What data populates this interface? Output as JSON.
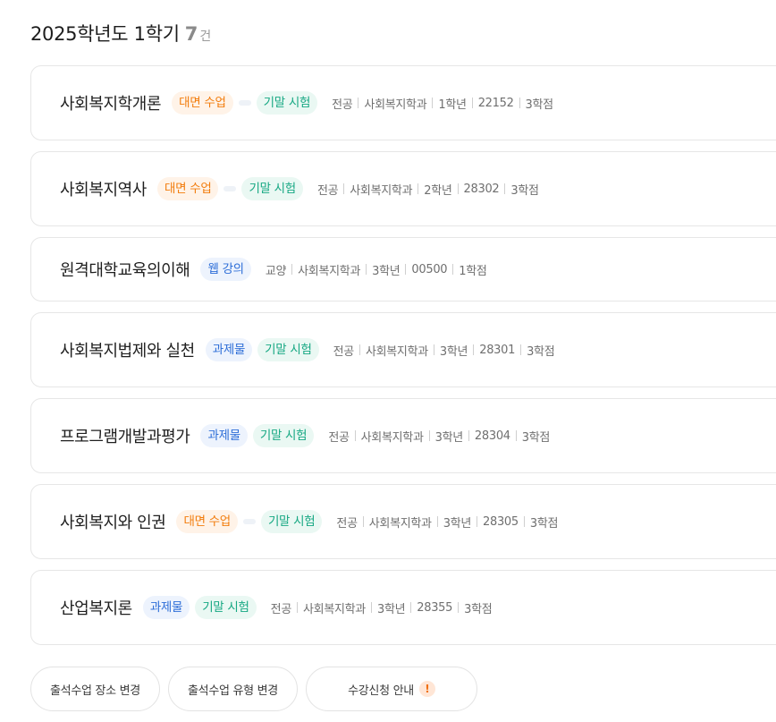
{
  "header": {
    "title": "2025학년도 1학기",
    "count": "7",
    "unit": "건"
  },
  "courses": [
    {
      "name": "사회복지학개론",
      "tags": [
        "대면 수업",
        "기말 시험"
      ],
      "meta": [
        "전공",
        "사회복지학과",
        "1학년",
        "22152",
        "3학점"
      ]
    },
    {
      "name": "사회복지역사",
      "tags": [
        "대면 수업",
        "기말 시험"
      ],
      "meta": [
        "전공",
        "사회복지학과",
        "2학년",
        "28302",
        "3학점"
      ]
    },
    {
      "name": "원격대학교육의이해",
      "tags": [
        "웹 강의"
      ],
      "meta": [
        "교양",
        "사회복지학과",
        "3학년",
        "00500",
        "1학점"
      ]
    },
    {
      "name": "사회복지법제와 실천",
      "tags": [
        "과제물",
        "기말 시험"
      ],
      "meta": [
        "전공",
        "사회복지학과",
        "3학년",
        "28301",
        "3학점"
      ]
    },
    {
      "name": "프로그램개발과평가",
      "tags": [
        "과제물",
        "기말 시험"
      ],
      "meta": [
        "전공",
        "사회복지학과",
        "3학년",
        "28304",
        "3학점"
      ]
    },
    {
      "name": "사회복지와 인권",
      "tags": [
        "대면 수업",
        "기말 시험"
      ],
      "meta": [
        "전공",
        "사회복지학과",
        "3학년",
        "28305",
        "3학점"
      ]
    },
    {
      "name": "산업복지론",
      "tags": [
        "과제물",
        "기말 시험"
      ],
      "meta": [
        "전공",
        "사회복지학과",
        "3학년",
        "28355",
        "3학점"
      ]
    }
  ],
  "buttons": {
    "change_location": "출석수업 장소 변경",
    "change_type": "출석수업 유형 변경",
    "registration_guide": "수강신청 안내",
    "warning_icon": "!"
  },
  "colors": {
    "orange_tag": "#f27c0c",
    "teal_tag": "#17a883",
    "blue_tag": "#2f6fd8"
  }
}
